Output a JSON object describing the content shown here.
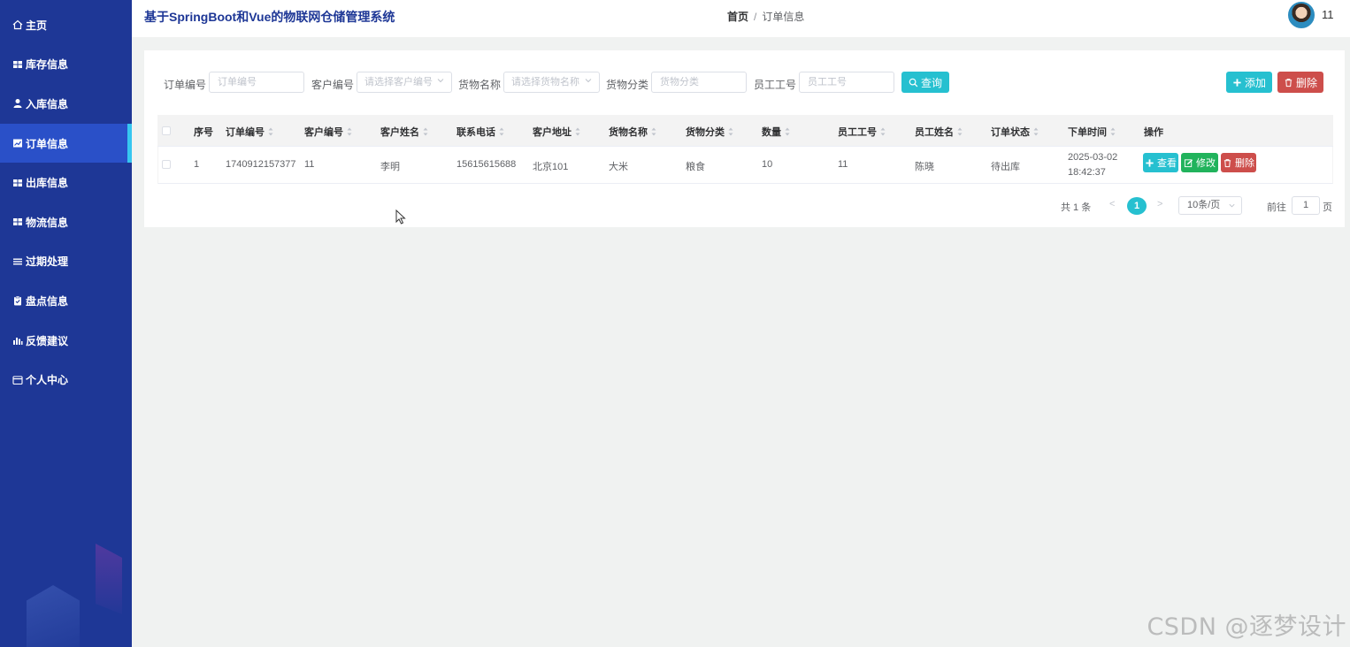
{
  "app": {
    "title": "基于SpringBoot和Vue的物联网仓储管理系统"
  },
  "breadcrumb": {
    "home": "首页",
    "separator": "/",
    "current": "订单信息"
  },
  "user": {
    "name": "11"
  },
  "sidebar": {
    "items": [
      {
        "label": "主页",
        "icon": "home-icon"
      },
      {
        "label": "库存信息",
        "icon": "grid-icon"
      },
      {
        "label": "入库信息",
        "icon": "user-icon"
      },
      {
        "label": "订单信息",
        "icon": "chart-icon",
        "active": true
      },
      {
        "label": "出库信息",
        "icon": "grid-icon"
      },
      {
        "label": "物流信息",
        "icon": "grid-icon"
      },
      {
        "label": "过期处理",
        "icon": "list-icon"
      },
      {
        "label": "盘点信息",
        "icon": "clipboard-icon"
      },
      {
        "label": "反馈建议",
        "icon": "bar-chart-icon"
      },
      {
        "label": "个人中心",
        "icon": "card-icon"
      }
    ]
  },
  "filters": {
    "order_no": {
      "label": "订单编号",
      "placeholder": "订单编号"
    },
    "customer_no": {
      "label": "客户编号",
      "placeholder": "请选择客户编号"
    },
    "goods_name": {
      "label": "货物名称",
      "placeholder": "请选择货物名称"
    },
    "goods_category": {
      "label": "货物分类",
      "placeholder": "货物分类"
    },
    "employee_no": {
      "label": "员工工号",
      "placeholder": "员工工号"
    },
    "search_label": "查询"
  },
  "toolbar": {
    "add_label": "添加",
    "delete_label": "删除"
  },
  "table": {
    "columns": [
      "序号",
      "订单编号",
      "客户编号",
      "客户姓名",
      "联系电话",
      "客户地址",
      "货物名称",
      "货物分类",
      "数量",
      "员工工号",
      "员工姓名",
      "订单状态",
      "下单时间",
      "操作"
    ],
    "rows": [
      {
        "index": "1",
        "order_no": "1740912157377",
        "customer_no": "11",
        "customer_name": "李明",
        "phone": "15615615688",
        "address": "北京101",
        "goods_name": "大米",
        "goods_category": "粮食",
        "quantity": "10",
        "employee_no": "11",
        "employee_name": "陈晓",
        "status": "待出库",
        "order_time": "2025-03-02 18:42:37"
      }
    ],
    "actions": {
      "view": "查看",
      "edit": "修改",
      "delete": "删除"
    }
  },
  "pagination": {
    "total": "共 1 条",
    "prev": "<",
    "current": "1",
    "next": ">",
    "page_size": "10条/页",
    "goto_label": "前往",
    "goto_value": "1",
    "page_suffix": "页"
  },
  "watermark": "CSDN @逐梦设计",
  "colors": {
    "sidebar": "#1e3796",
    "active": "#2a50c8",
    "accent": "#26c0d0",
    "danger": "#cd4e4b",
    "success": "#21b35c"
  }
}
